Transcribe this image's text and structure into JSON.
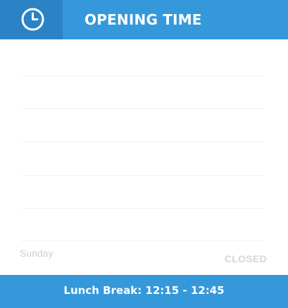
{
  "header": {
    "icon": "clock-icon",
    "title": "OPENING TIME"
  },
  "schedule": {
    "visible_day": {
      "day": "Sunday",
      "status": "CLOSED"
    }
  },
  "footer": {
    "lunch_break": "Lunch Break: 12:15 - 12:45"
  },
  "colors": {
    "header_bg": "#3498db",
    "icon_box_bg": "#2b83c6",
    "footer_bg": "#3498db",
    "muted_text": "#d0d0d0"
  }
}
